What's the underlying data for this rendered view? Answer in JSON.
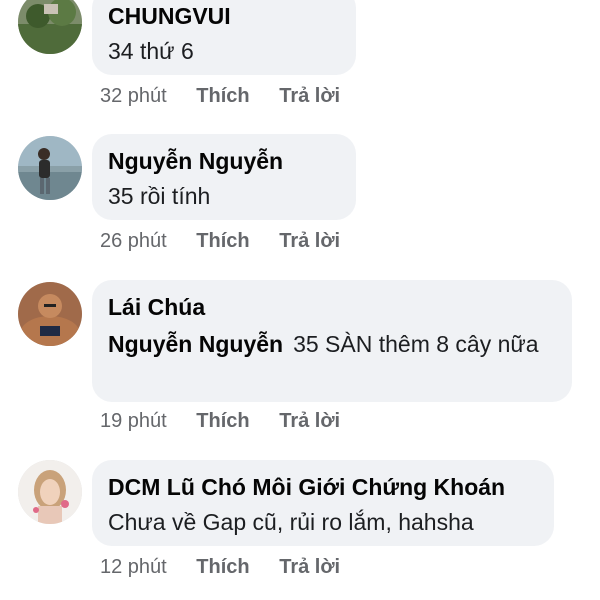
{
  "comments": [
    {
      "author": "CHUNGVUI",
      "text": "34 thứ 6",
      "time": "32 phút",
      "like_label": "Thích",
      "reply_label": "Trả lời",
      "avatar": "landscape-photo-avatar"
    },
    {
      "author": "Nguyễn Nguyễn",
      "text": "35 rồi tính",
      "time": "26 phút",
      "like_label": "Thích",
      "reply_label": "Trả lời",
      "avatar": "person-walking-avatar"
    },
    {
      "author": "Lái Chúa",
      "mention": "Nguyễn Nguyễn",
      "text": "35 SÀN thêm 8 cây nữa",
      "time": "19 phút",
      "like_label": "Thích",
      "reply_label": "Trả lời",
      "avatar": "bodybuilder-avatar"
    },
    {
      "author": "DCM Lũ Chó Môi Giới Chứng Khoán",
      "text": "Chưa về Gap cũ, rủi ro lắm, hahsha",
      "time": "12 phút",
      "like_label": "Thích",
      "reply_label": "Trả lời",
      "avatar": "girl-photo-avatar"
    }
  ],
  "colors": {
    "bubble": "#f0f2f5",
    "meta_text": "#65676b",
    "author_text": "#050505"
  }
}
